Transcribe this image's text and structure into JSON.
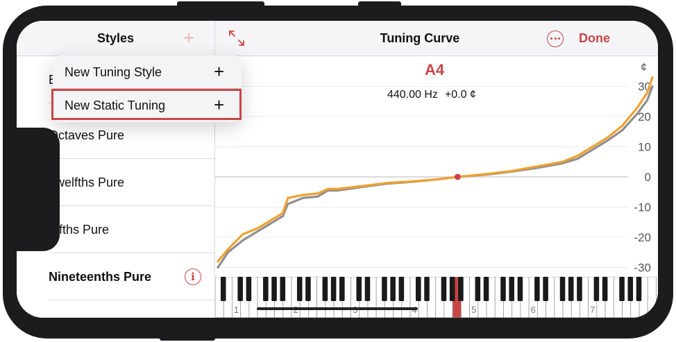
{
  "left_pane": {
    "title": "Styles",
    "add_icon": "plus-icon",
    "items": [
      {
        "label": "E",
        "bold": false
      },
      {
        "label": "",
        "bold": false
      },
      {
        "label": "Octaves Pure",
        "bold": false
      },
      {
        "label": "Twelfths Pure",
        "bold": false
      },
      {
        "label": "Fifths Pure",
        "bold": false
      },
      {
        "label": "Nineteenths Pure",
        "bold": true,
        "info_icon": "info-icon"
      }
    ]
  },
  "menu": {
    "items": [
      {
        "label": "New Tuning Style",
        "icon": "plus-icon"
      },
      {
        "label": "New Static Tuning",
        "icon": "plus-icon",
        "highlighted": true
      }
    ]
  },
  "header": {
    "title": "Tuning Curve",
    "done_label": "Done",
    "expand_icon": "expand-arrows-icon",
    "more_icon": "ellipsis-circle-icon"
  },
  "note": {
    "name": "A4",
    "frequency": "440.00 Hz",
    "cents": "+0.0 ¢"
  },
  "colors": {
    "accent": "#c94545",
    "curve": "#f0a030",
    "reference_curve": "#8e8e8e"
  },
  "chart_data": {
    "type": "line",
    "unit_label": "¢",
    "ylim": [
      -31,
      31
    ],
    "yticks": [
      30,
      20,
      10,
      0,
      -10,
      -20,
      -30
    ],
    "x_range": [
      1,
      88
    ],
    "series": [
      {
        "x": [
          1,
          3,
          6,
          9,
          12,
          14,
          15,
          18,
          21,
          23,
          25,
          30,
          35,
          40,
          45,
          49,
          55,
          60,
          65,
          70,
          73,
          76,
          79,
          82,
          85,
          87,
          88
        ],
        "values": [
          -28,
          -24,
          -19,
          -17,
          -14,
          -12,
          -7,
          -6,
          -5.5,
          -4,
          -4,
          -3,
          -2,
          -1.5,
          -0.8,
          0,
          1,
          2,
          3.5,
          5,
          7,
          10,
          13,
          17,
          23,
          28,
          33
        ]
      },
      {
        "x": [
          1,
          3,
          6,
          9,
          12,
          14,
          15,
          18,
          21,
          23,
          25,
          30,
          35,
          40,
          45,
          49,
          55,
          60,
          65,
          70,
          73,
          76,
          79,
          82,
          85,
          87,
          88
        ],
        "values": [
          -30,
          -25,
          -21,
          -18,
          -15,
          -13,
          -9,
          -7,
          -6.5,
          -4.5,
          -4.5,
          -3.3,
          -2.2,
          -1.6,
          -0.8,
          0,
          0.8,
          1.8,
          3,
          4.5,
          6,
          9,
          12,
          15.5,
          21,
          25.5,
          30
        ]
      }
    ],
    "highlight_point": {
      "x": 49,
      "y": 0
    },
    "keyboard": {
      "octave_labels": [
        "1",
        "2",
        "3",
        "4",
        "5",
        "6",
        "7"
      ],
      "highlighted_key": "A4"
    }
  }
}
